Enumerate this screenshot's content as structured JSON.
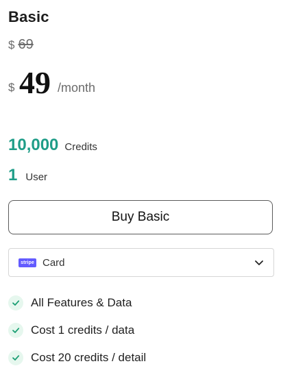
{
  "plan": {
    "name": "Basic",
    "currency": "$",
    "original_price": "69",
    "price": "49",
    "period": "/month"
  },
  "stats": {
    "credits_value": "10,000",
    "credits_label": "Credits",
    "users_value": "1",
    "users_label": "User"
  },
  "buy_button": {
    "label": "Buy Basic"
  },
  "payment": {
    "badge_text": "stripe",
    "method": "Card",
    "badge_color": "#635bff"
  },
  "features": [
    "All Features & Data",
    "Cost 1 credits / data",
    "Cost 20 credits / detail"
  ],
  "colors": {
    "accent": "#1f9d88",
    "check_bg": "#e6f7ee",
    "check_stroke": "#1a9e73"
  },
  "icons": {
    "dropdown": "chevron-down-icon",
    "feature": "check-icon"
  }
}
